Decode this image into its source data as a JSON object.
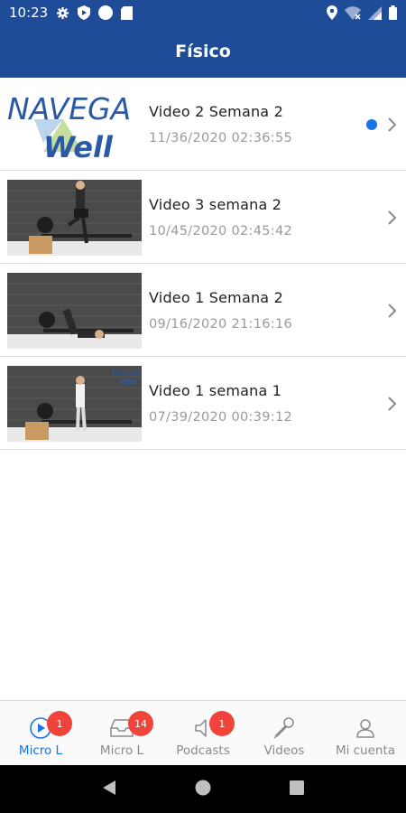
{
  "status_bar": {
    "time": "10:23"
  },
  "app_bar": {
    "title": "Físico"
  },
  "videos": [
    {
      "title": "Video 2 Semana 2",
      "date": "11/36/2020 02:36:55",
      "unread": true,
      "thumbnail": "navegawell-logo"
    },
    {
      "title": "Video 3 semana 2",
      "date": "10/45/2020 02:45:42",
      "unread": false,
      "thumbnail": "gym-photo"
    },
    {
      "title": "Video 1 Semana 2",
      "date": "09/16/2020 21:16:16",
      "unread": false,
      "thumbnail": "gym-photo"
    },
    {
      "title": "Video 1 semana 1",
      "date": "07/39/2020 00:39:12",
      "unread": false,
      "thumbnail": "gym-photo"
    }
  ],
  "logo": {
    "line1": "NAVEGA",
    "line2": "Well",
    "small_line1": "NAVEGA",
    "small_line2": "Well"
  },
  "tabs": [
    {
      "label": "Micro L",
      "icon": "play-circle-icon",
      "badge": "1",
      "active": true
    },
    {
      "label": "Micro L",
      "icon": "inbox-icon",
      "badge": "14",
      "active": false
    },
    {
      "label": "Podcasts",
      "icon": "speaker-icon",
      "badge": "1",
      "active": false
    },
    {
      "label": "Videos",
      "icon": "microphone-icon",
      "badge": "",
      "active": false
    },
    {
      "label": "Mi cuenta",
      "icon": "user-icon",
      "badge": "",
      "active": false
    }
  ],
  "colors": {
    "primary": "#1f4c99",
    "accent": "#1a73e8",
    "badge": "#f0443b"
  }
}
